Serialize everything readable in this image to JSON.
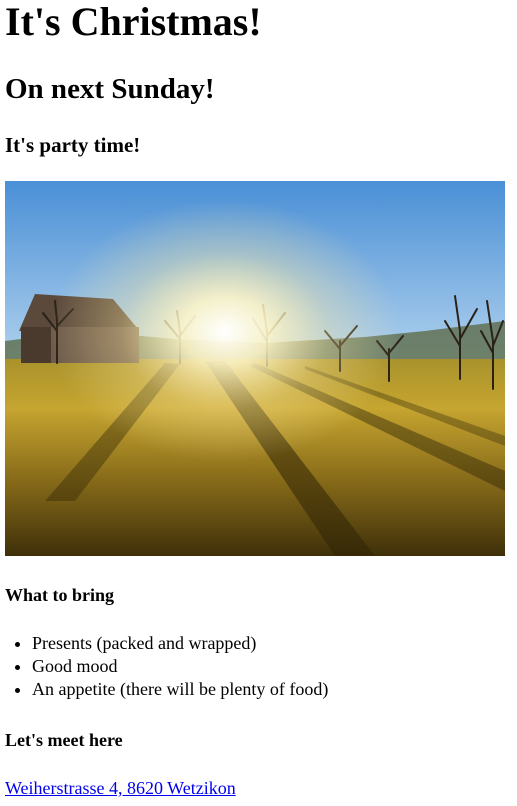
{
  "heading_main": "It's Christmas!",
  "heading_date": "On next Sunday!",
  "heading_party": "It's party time!",
  "image": {
    "subject": "sunlit meadow with barn and bare trees"
  },
  "bring": {
    "heading": "What to bring",
    "items": [
      "Presents (packed and wrapped)",
      "Good mood",
      "An appetite (there will be plenty of food)"
    ]
  },
  "meet": {
    "heading": "Let's meet here",
    "address_link": "Weiherstrasse 4, 8620 Wetzikon"
  },
  "colors": {
    "link": "#0000ee",
    "text": "#000000",
    "background": "#ffffff"
  }
}
